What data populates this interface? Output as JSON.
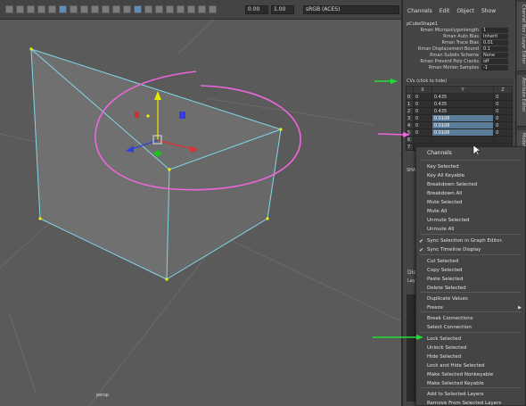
{
  "toolbar": {
    "exposure": "0.00",
    "gamma": "1.00",
    "color_space": "sRGB (ACES)"
  },
  "viewport": {
    "camera": "persp"
  },
  "channel_box": {
    "menus": [
      "Channels",
      "Edit",
      "Object",
      "Show"
    ],
    "object_name": "pCubeShape1",
    "attributes": [
      {
        "label": "Rman Micropolygonlength",
        "value": "1"
      },
      {
        "label": "Rman Auto Bias",
        "value": "Inherit"
      },
      {
        "label": "Rman Trace Bias",
        "value": "0.01"
      },
      {
        "label": "Rman Displacement Bound",
        "value": "0.1"
      },
      {
        "label": "Rman Subdiv Scheme",
        "value": "None"
      },
      {
        "label": "Rman Prevent Poly Cracks",
        "value": "off"
      },
      {
        "label": "Rman Motion Samples",
        "value": "-1"
      }
    ],
    "cvs_header": "CVs (click to hide)",
    "cv_columns": [
      "X",
      "Y",
      "Z"
    ],
    "cv_rows": [
      {
        "idx": "0",
        "x": "0",
        "y": "0.435",
        "z": "0",
        "sel": false
      },
      {
        "idx": "1",
        "x": "0",
        "y": "0.435",
        "z": "0",
        "sel": false
      },
      {
        "idx": "2",
        "x": "0",
        "y": "0.435",
        "z": "0",
        "sel": false
      },
      {
        "idx": "3",
        "x": "0",
        "y": "0.0106",
        "z": "0",
        "sel": true
      },
      {
        "idx": "4",
        "x": "0",
        "y": "0.0106",
        "z": "0",
        "sel": true
      },
      {
        "idx": "5",
        "x": "0",
        "y": "0.0106",
        "z": "0",
        "sel": true
      },
      {
        "idx": "6",
        "x": "",
        "y": "",
        "z": "",
        "sel": false
      },
      {
        "idx": "7",
        "x": "",
        "y": "",
        "z": "",
        "sel": false
      }
    ],
    "shapes_label": "SHAPES",
    "display_label": "Dis",
    "layers_label": "Lay"
  },
  "side_tabs": [
    "Channel Box / Layer Editor",
    "Attribute Editor",
    "Modeling Toolkit"
  ],
  "context_menu": {
    "title": "Channels",
    "items": [
      {
        "label": "Key Selected",
        "check": false,
        "submenu": false
      },
      {
        "label": "Key All Keyable",
        "check": false,
        "submenu": false
      },
      {
        "label": "Breakdown Selected",
        "check": false,
        "submenu": false
      },
      {
        "label": "Breakdown All",
        "check": false,
        "submenu": false
      },
      {
        "label": "Mute Selected",
        "check": false,
        "submenu": false
      },
      {
        "label": "Mute All",
        "check": false,
        "submenu": false
      },
      {
        "label": "Unmute Selected",
        "check": false,
        "submenu": false
      },
      {
        "label": "Unmute All",
        "check": false,
        "submenu": false
      },
      {
        "label": "Sync Selection in Graph Editor.",
        "check": true,
        "submenu": false
      },
      {
        "label": "Sync Timeline Display",
        "check": true,
        "submenu": false
      },
      {
        "label": "Cut Selected",
        "check": false,
        "submenu": false
      },
      {
        "label": "Copy Selected",
        "check": false,
        "submenu": false
      },
      {
        "label": "Paste Selected",
        "check": false,
        "submenu": false
      },
      {
        "label": "Delete Selected",
        "check": false,
        "submenu": false
      },
      {
        "label": "Duplicate Values",
        "check": false,
        "submenu": false
      },
      {
        "label": "Freeze",
        "check": false,
        "submenu": true
      },
      {
        "label": "Break Connections",
        "check": false,
        "submenu": false
      },
      {
        "label": "Select Connection",
        "check": false,
        "submenu": false
      },
      {
        "label": "Lock Selected",
        "check": false,
        "submenu": false
      },
      {
        "label": "Unlock Selected",
        "check": false,
        "submenu": false
      },
      {
        "label": "Hide Selected",
        "check": false,
        "submenu": false
      },
      {
        "label": "Lock and Hide Selected",
        "check": false,
        "submenu": false
      },
      {
        "label": "Make Selected Nonkeyable",
        "check": false,
        "submenu": false
      },
      {
        "label": "Make Selected Keyable",
        "check": false,
        "submenu": false
      },
      {
        "label": "Add to Selected Layers",
        "check": false,
        "submenu": false
      },
      {
        "label": "Remove From Selected Layers",
        "check": false,
        "submenu": false
      }
    ]
  },
  "colors": {
    "annotation_green": "#22dd33",
    "annotation_magenta": "#ee66dd",
    "wire": "#7fd8e8",
    "vertex": "#f0f000",
    "selection_blue": "#5c7d9a"
  }
}
